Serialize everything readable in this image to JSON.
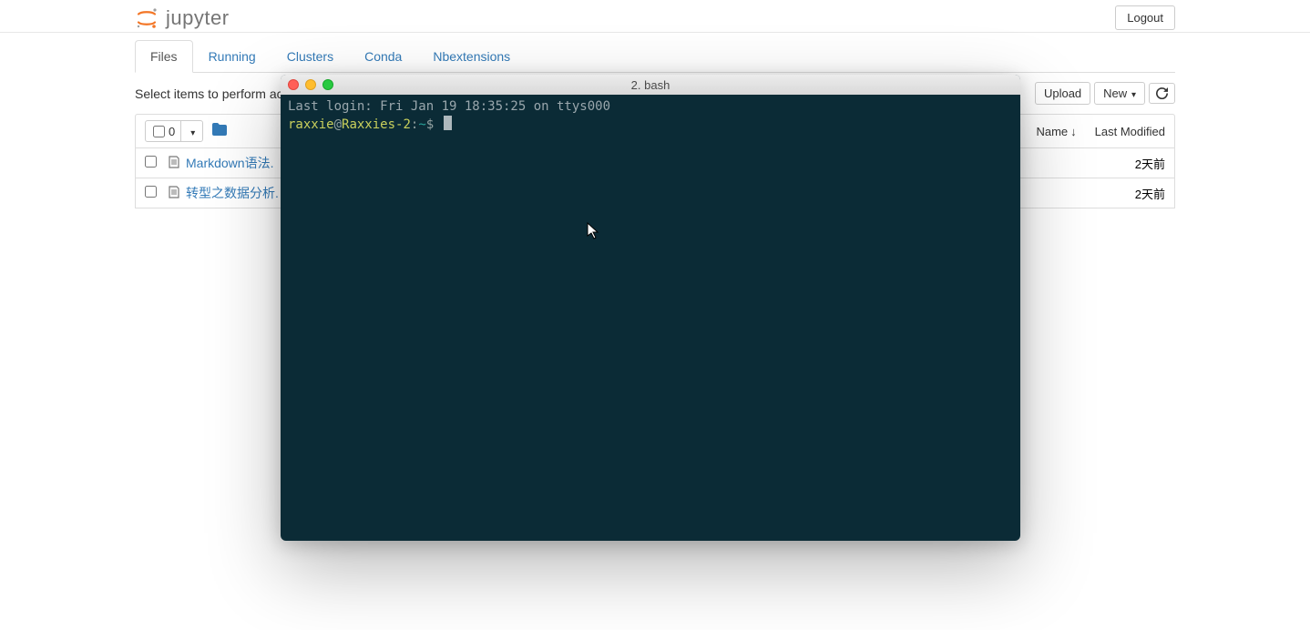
{
  "header": {
    "logo_text": "jupyter",
    "logout_label": "Logout"
  },
  "tabs": [
    {
      "label": "Files",
      "active": true
    },
    {
      "label": "Running",
      "active": false
    },
    {
      "label": "Clusters",
      "active": false
    },
    {
      "label": "Conda",
      "active": false
    },
    {
      "label": "Nbextensions",
      "active": false
    }
  ],
  "toolbar": {
    "hint": "Select items to perform act",
    "upload_label": "Upload",
    "new_label": "New"
  },
  "list_header": {
    "select_count": "0",
    "name_label": "Name",
    "last_modified_label": "Last Modified"
  },
  "files": [
    {
      "name": "Markdown语法.",
      "last_modified": "2天前"
    },
    {
      "name": "转型之数据分析.",
      "last_modified": "2天前"
    }
  ],
  "terminal": {
    "title": "2. bash",
    "last_login": "Last login: Fri Jan 19 18:35:25 on ttys000",
    "prompt_user": "raxxie",
    "prompt_at": "@",
    "prompt_host": "Raxxies-2",
    "prompt_sep": ":",
    "prompt_path": "~",
    "prompt_symbol": "$"
  }
}
